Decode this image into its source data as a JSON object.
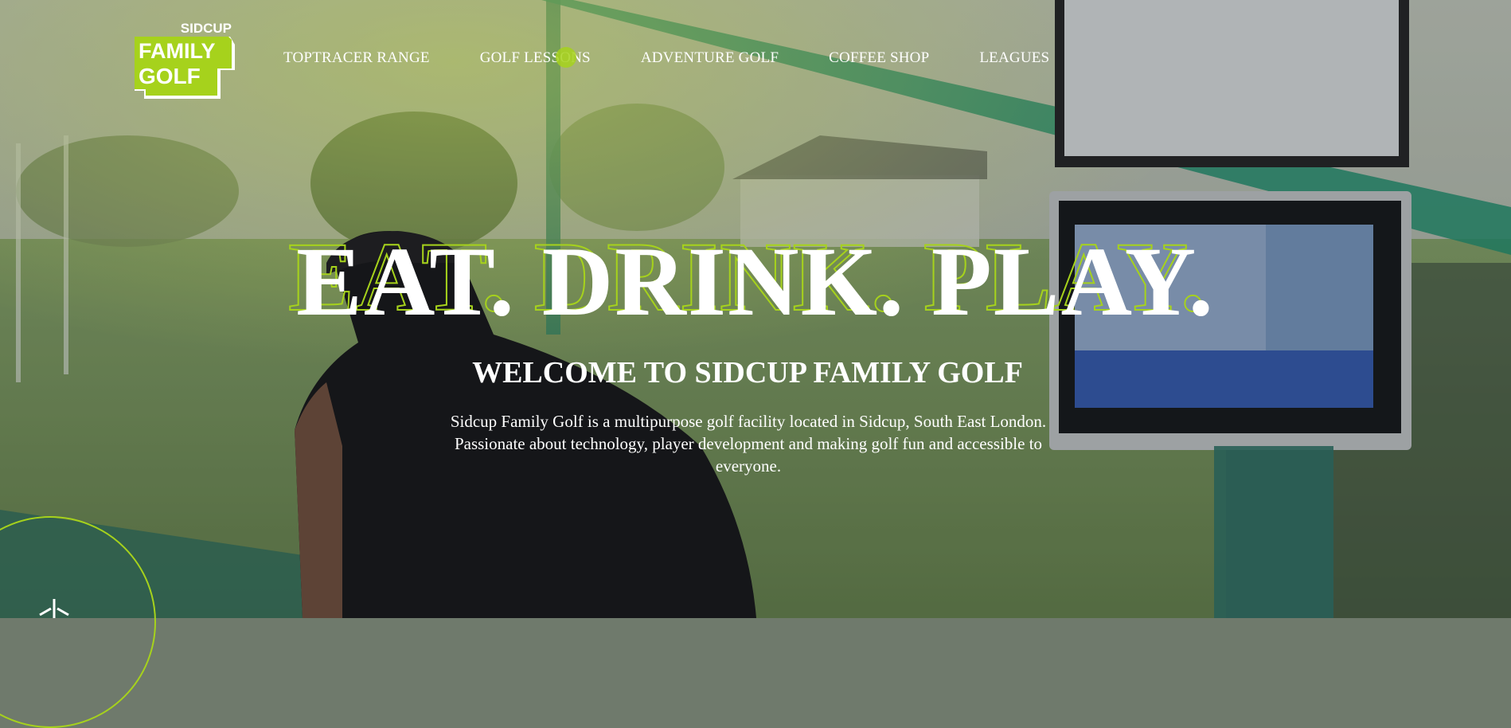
{
  "brand": {
    "logo_text_top": "SIDCUP",
    "logo_text_mid": "FAMILY",
    "logo_text_bot": "GOLF",
    "accent_color": "#a6d21c"
  },
  "nav": {
    "items": [
      {
        "label": "TOPTRACER RANGE"
      },
      {
        "label": "GOLF LESSONS"
      },
      {
        "label": "ADVENTURE GOLF"
      },
      {
        "label": "COFFEE SHOP"
      },
      {
        "label": "LEAGUES"
      }
    ]
  },
  "hero": {
    "headline": "EAT. DRINK. PLAY.",
    "welcome": "WELCOME TO SIDCUP FAMILY GOLF",
    "description": "Sidcup Family Golf is a multipurpose golf facility located in Sidcup, South East London. Passionate about technology, player development and making golf fun and accessible to everyone."
  },
  "icons": {
    "scroll_indicator": "sparkle-icon"
  }
}
